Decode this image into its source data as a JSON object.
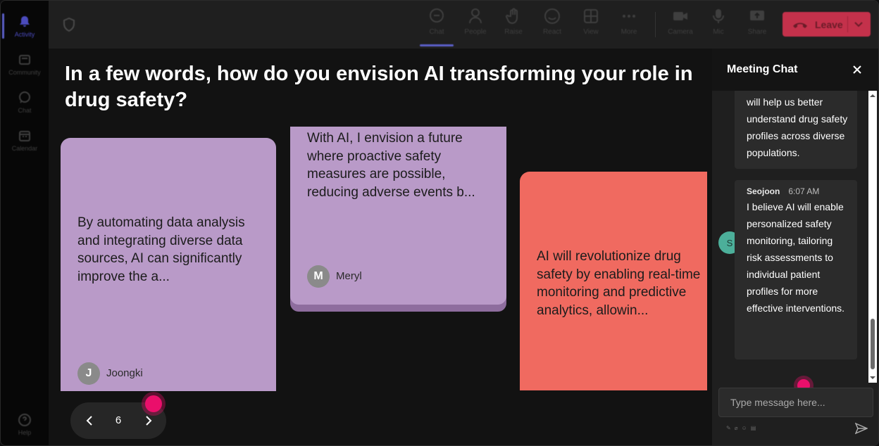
{
  "rail": {
    "items": [
      {
        "label": "Activity",
        "icon": "bell-icon"
      },
      {
        "label": "Community",
        "icon": "community-icon"
      },
      {
        "label": "Chat",
        "icon": "chat-icon"
      },
      {
        "label": "Calendar",
        "icon": "calendar-icon"
      }
    ],
    "help_label": "Help"
  },
  "toolbar": {
    "chat": "Chat",
    "people": "People",
    "raise": "Raise",
    "react": "React",
    "view": "View",
    "more": "More",
    "camera": "Camera",
    "mic": "Mic",
    "share": "Share",
    "leave": "Leave"
  },
  "stage": {
    "question": "In a few words, how do you envision AI transforming your role in drug safety?",
    "cards": [
      {
        "text": "By automating data analysis and integrating diverse data sources, AI can significantly improve the a...",
        "author": "Joongki",
        "initial": "J",
        "color": "#b99ac8"
      },
      {
        "text": "With AI, I envision a future where proactive safety measures are possible, reducing adverse events b...",
        "author": "Meryl",
        "initial": "M",
        "color": "#b99ac8"
      },
      {
        "text": "AI will revolutionize drug safety by enabling real-time monitoring and predictive analytics, allowin...",
        "color": "#f06a60"
      }
    ],
    "page": "6"
  },
  "chat": {
    "title": "Meeting Chat",
    "messages": [
      {
        "text": "will help us better understand drug safety profiles across diverse populations."
      },
      {
        "sender": "Seojoon",
        "initial": "S",
        "time": "6:07 AM",
        "text": "I believe AI will enable personalized safety monitoring, tailoring risk assessments to individual patient profiles for more effective interventions."
      }
    ],
    "placeholder": "Type message here..."
  },
  "colors": {
    "accent": "#5b5fc7",
    "leave": "#c4314b",
    "pointer_dot": "#ea0f6b",
    "card_purple": "#b99ac8",
    "card_coral": "#f06a60",
    "avatar_teal": "#4caf9a"
  }
}
